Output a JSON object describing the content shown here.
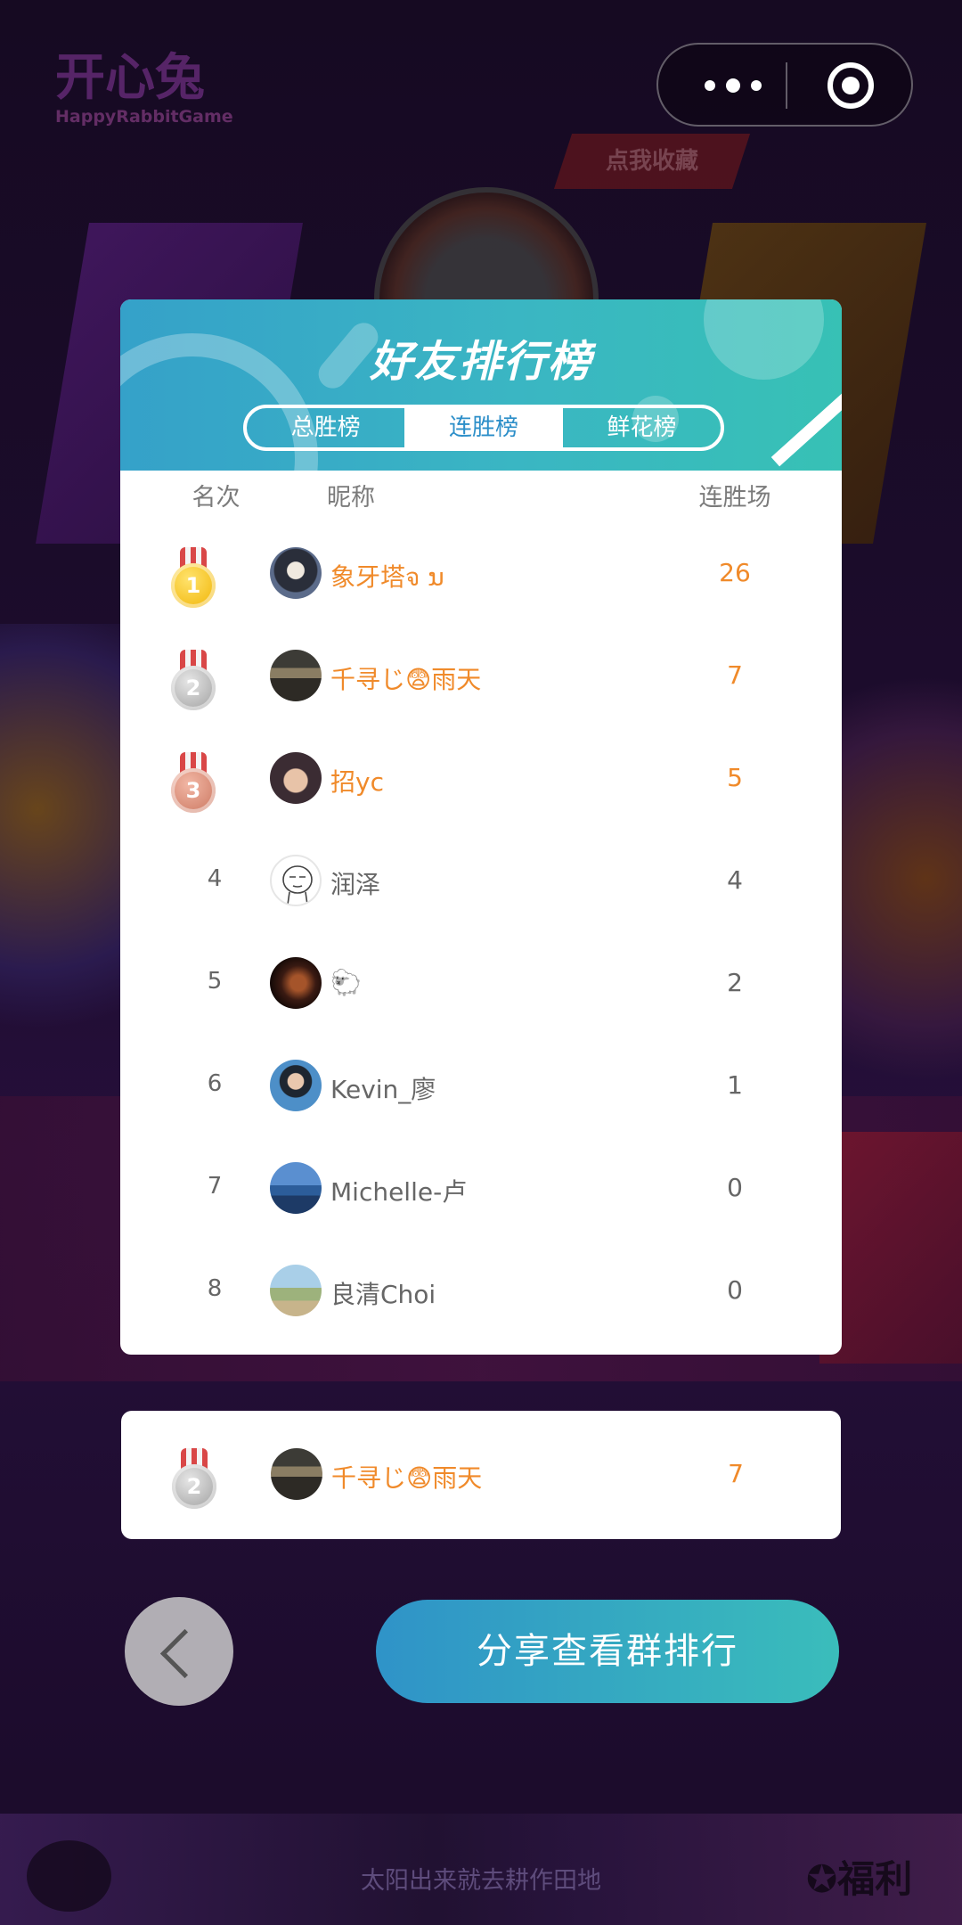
{
  "background": {
    "logo_text": "开心兔",
    "logo_sub": "HappyRabbitGame",
    "banner_text": "点我收藏",
    "bottom_right_text": "✪福利"
  },
  "header": {
    "title": "好友排行榜"
  },
  "tabs": [
    {
      "label": "总胜榜",
      "active": false
    },
    {
      "label": "连胜榜",
      "active": true
    },
    {
      "label": "鲜花榜",
      "active": false
    }
  ],
  "columns": {
    "rank": "名次",
    "nickname": "昵称",
    "score": "连胜场"
  },
  "rows": [
    {
      "rank": "1",
      "nickname": "象牙塔จ  ນ",
      "score": "26",
      "medal": "gold"
    },
    {
      "rank": "2",
      "nickname": "千寻じ😨雨天",
      "score": "7",
      "medal": "silver"
    },
    {
      "rank": "3",
      "nickname": "招yc",
      "score": "5",
      "medal": "bronze"
    },
    {
      "rank": "4",
      "nickname": "润泽",
      "score": "4"
    },
    {
      "rank": "5",
      "nickname": "🐑",
      "score": "2"
    },
    {
      "rank": "6",
      "nickname": "Kevin_廖",
      "score": "1"
    },
    {
      "rank": "7",
      "nickname": "Michelle-卢",
      "score": "0"
    },
    {
      "rank": "8",
      "nickname": "良清Choi",
      "score": "0"
    }
  ],
  "my_rank": {
    "rank": "2",
    "nickname": "千寻じ😨雨天",
    "score": "7",
    "medal": "silver"
  },
  "actions": {
    "share_label": "分享查看群排行"
  },
  "footer": {
    "text": "太阳出来就去耕作田地"
  },
  "colors": {
    "accent_teal": "#3ab6c3",
    "accent_blue": "#2d8fc9",
    "top_rank_orange": "#f08a2a"
  }
}
